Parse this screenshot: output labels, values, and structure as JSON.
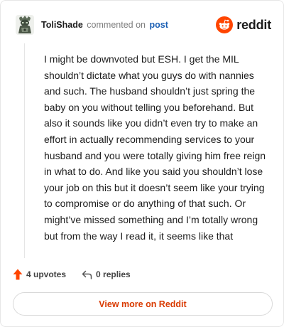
{
  "header": {
    "username": "ToliShade",
    "verb": "commented on",
    "post_link": "post",
    "brand": "reddit"
  },
  "comment": {
    "text": "I might be downvoted but ESH. I get the MIL shouldn’t dictate what you guys do with nannies and such. The husband shouldn’t just spring the baby on you without telling you beforehand. But also it sounds like you didn’t even try to make an effort in actually recommending services to your husband and you were totally giving him free reign in what to do. And like you said you shouldn’t lose your job on this but it doesn’t seem like your trying to compromise or do anything of that such. Or might’ve missed something and I’m totally wrong but from the way I read it, it seems like that"
  },
  "actions": {
    "upvotes": "4 upvotes",
    "replies": "0 replies"
  },
  "footer": {
    "view_more": "View more on Reddit"
  },
  "colors": {
    "accent": "#ff4500",
    "link": "#1a5fb4",
    "button_text": "#d93a00"
  },
  "icons": {
    "avatar": "user-avatar",
    "logo": "reddit-snoo-icon",
    "upvote": "upvote-arrow-icon",
    "reply": "reply-arrow-icon"
  }
}
